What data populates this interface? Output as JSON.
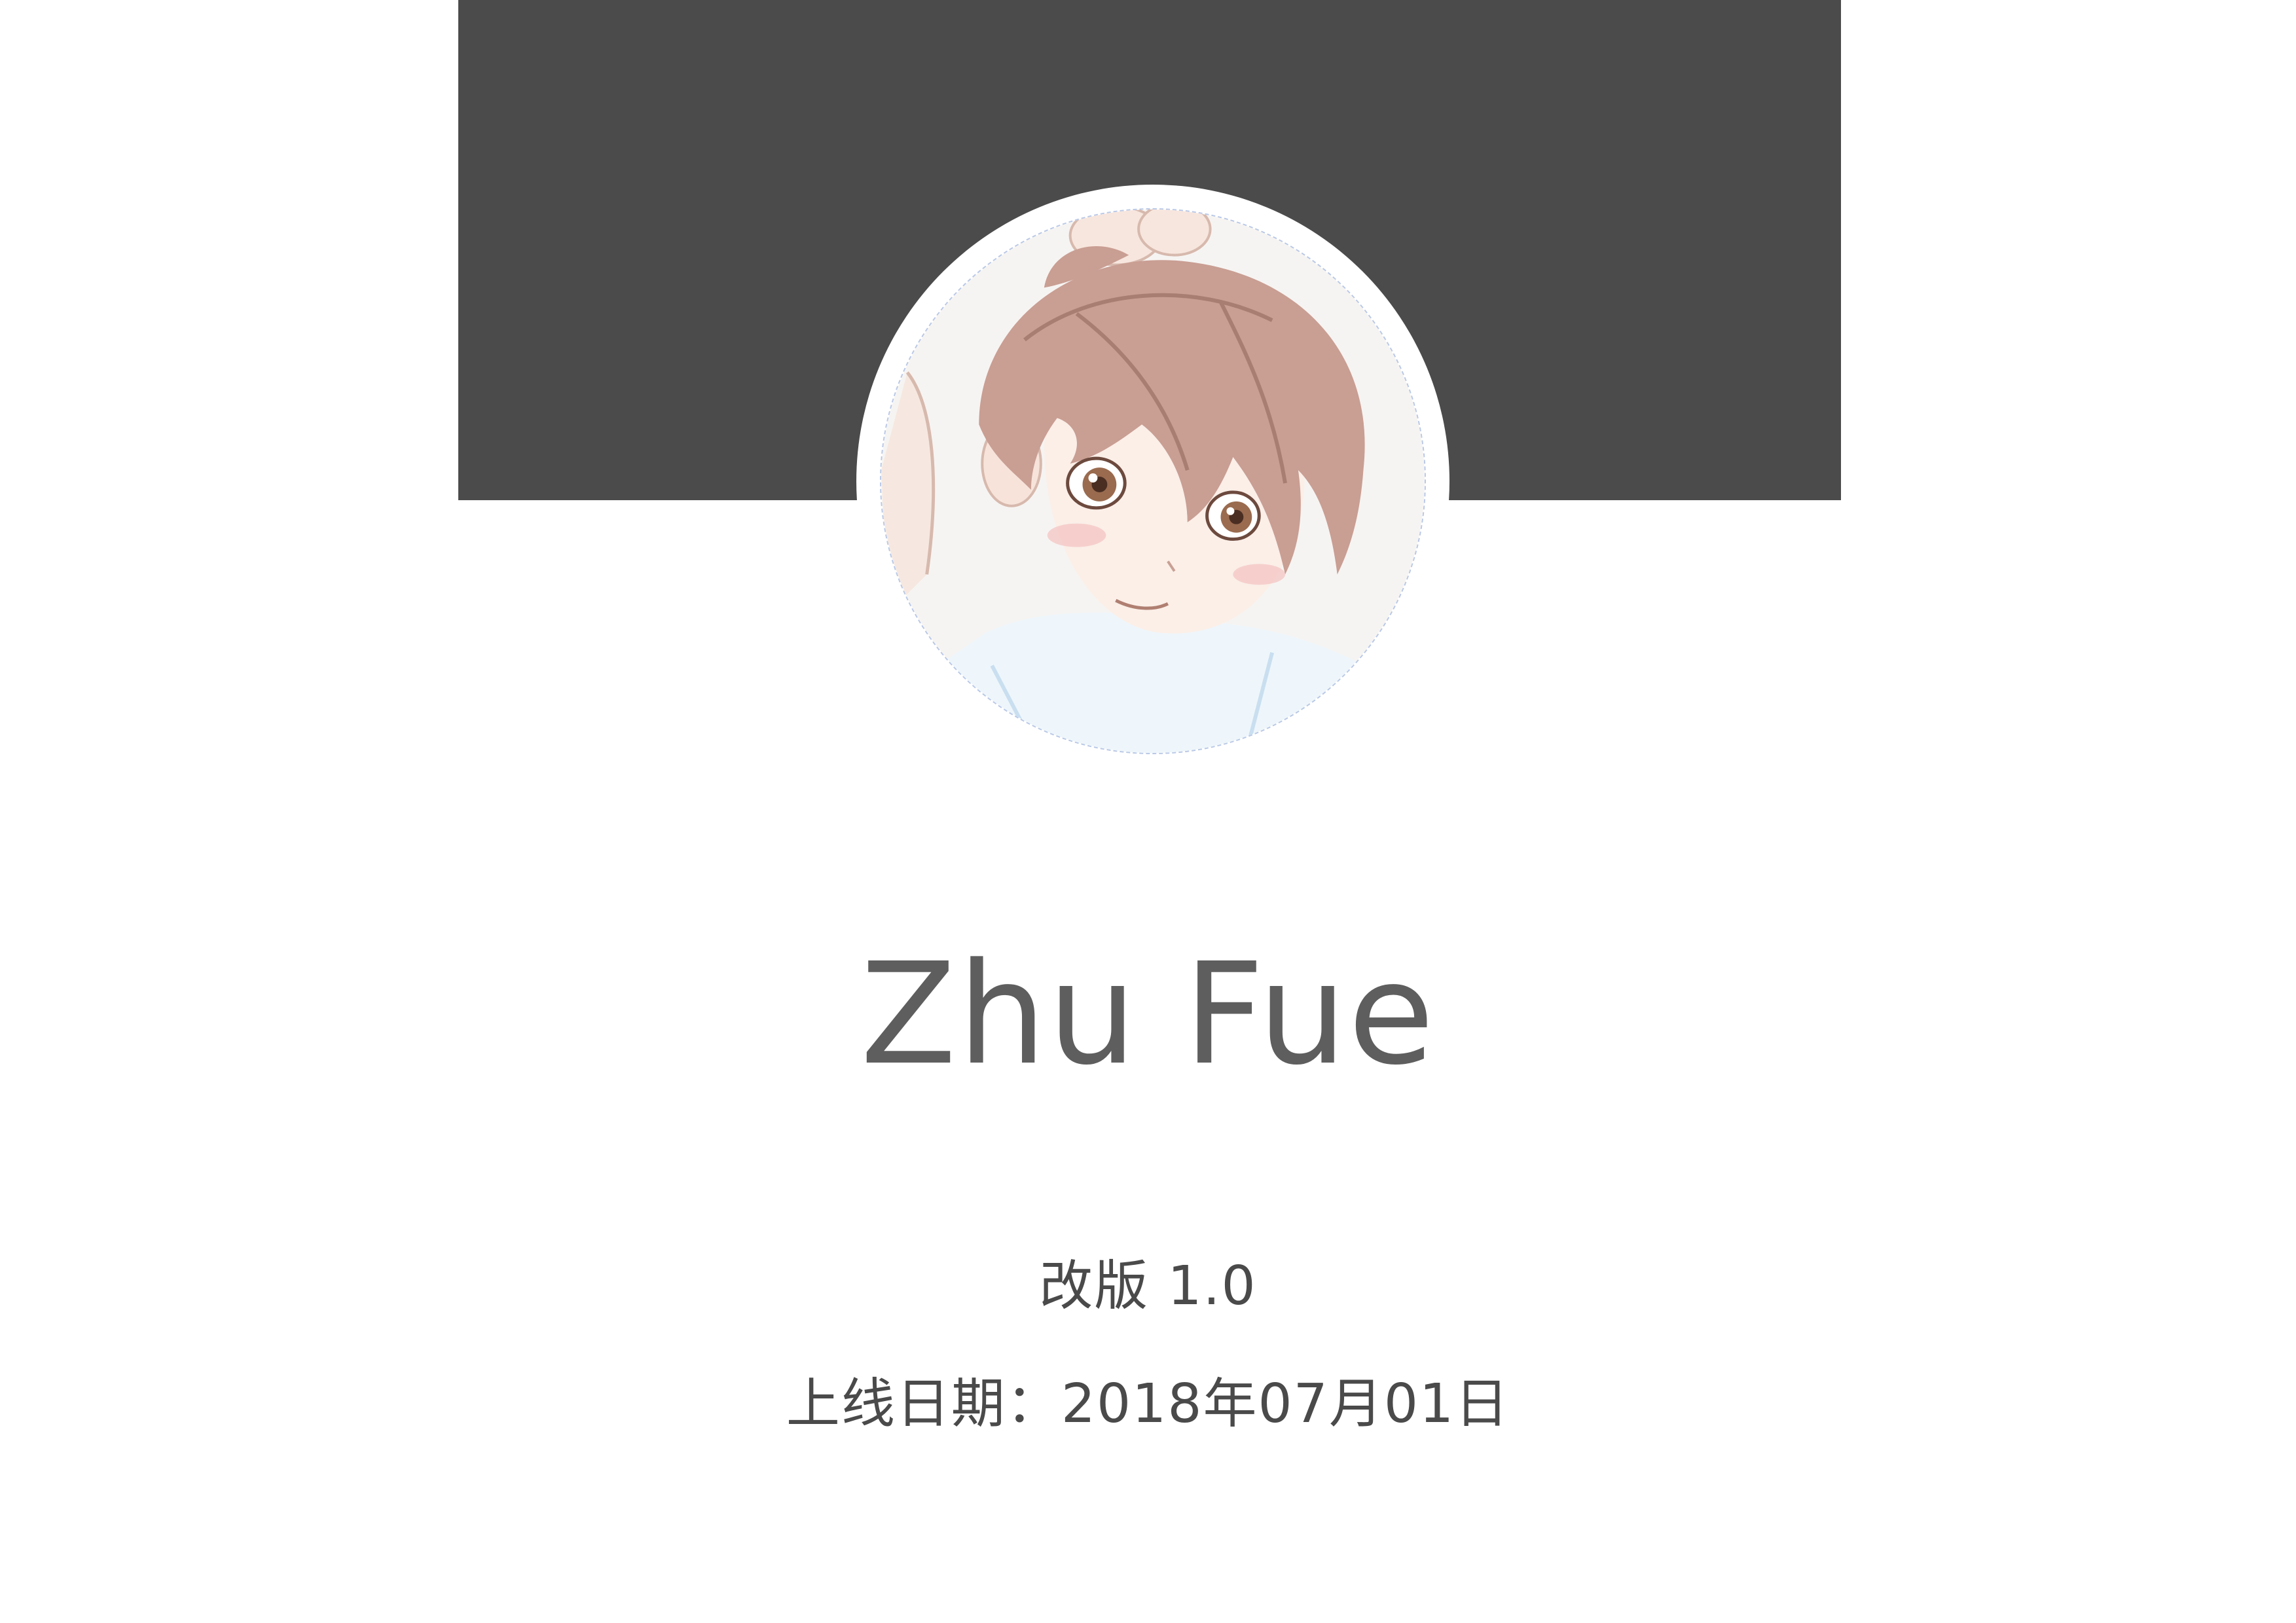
{
  "profile": {
    "name": "Zhu Fue",
    "avatar_icon": "anime-girl-avatar"
  },
  "info": {
    "version": "改版 1.0",
    "launch_date": "上线日期：2018年07月01日"
  },
  "colors": {
    "banner": "#4b4b4b",
    "background": "#ffffff",
    "name_text": "#5e5e5e",
    "info_text": "#4a4a4a"
  }
}
